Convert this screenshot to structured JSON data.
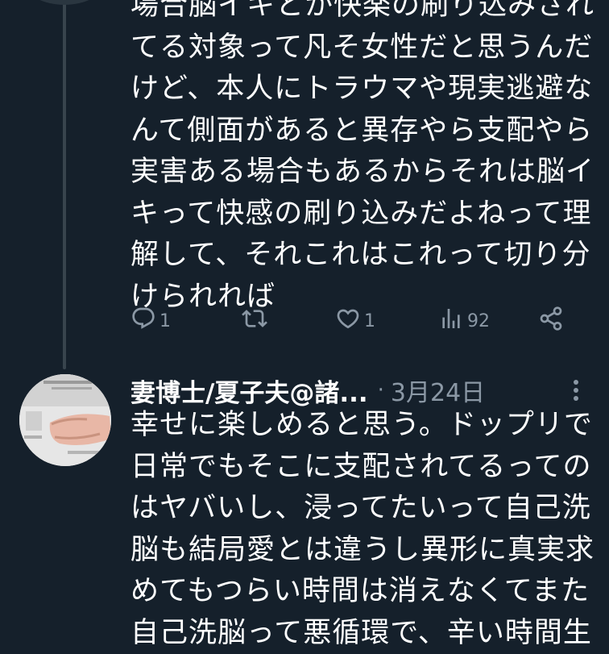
{
  "tweet1": {
    "lines": [
      "場合脳イキとか快楽の刷り込みされ",
      "てる対象って凡そ女性だと思うんだ",
      "けど、本人にトラウマや現実逃避な",
      "んて側面があると異存やら支配やら",
      "実害ある場合もあるからそれは脳イ",
      "キって快感の刷り込みだよねって理",
      "解して、それこれはこれって切り分",
      "けられれば"
    ],
    "actions": {
      "reply_count": "1",
      "retweet_count": "",
      "like_count": "1",
      "views_count": "92"
    }
  },
  "tweet2": {
    "author_name": "妻博士/夏子夫@諸...",
    "separator": "·",
    "date": "3月24日",
    "lines": [
      "幸せに楽しめると思う。ドップリで",
      "日常でもそこに支配されてるっての",
      "はヤバいし、浸ってたいって自己洗",
      "脳も結局愛とは違うし異形に真実求",
      "めてもつらい時間は消えなくてまた",
      "自己洗脳って悪循環で、辛い時間生"
    ]
  },
  "icons": {
    "reply": "reply-icon",
    "retweet": "retweet-icon",
    "like": "heart-icon",
    "views": "views-icon",
    "share": "share-icon",
    "more": "more-icon"
  },
  "colors": {
    "background": "#15202b",
    "text": "#ffffff",
    "secondary": "#8b98a5",
    "thread_line": "#38444d"
  }
}
